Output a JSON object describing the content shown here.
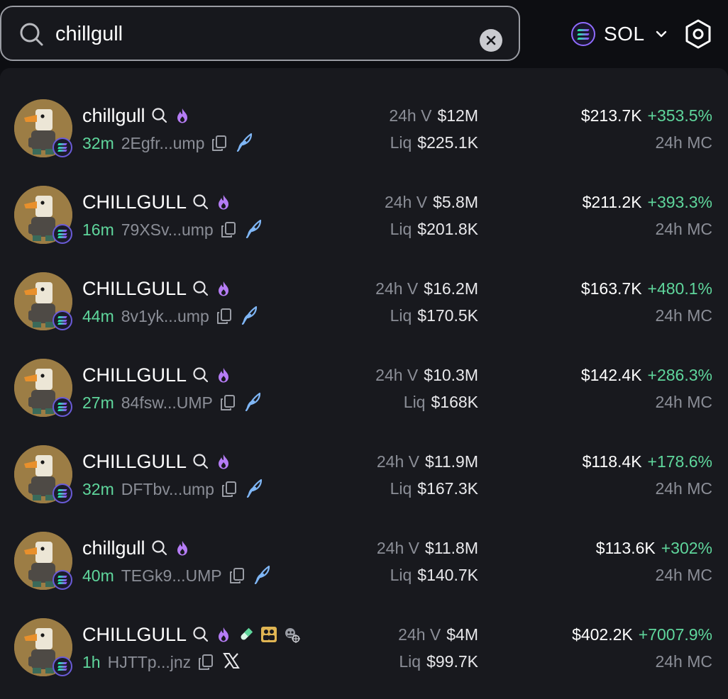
{
  "search": {
    "value": "chillgull",
    "placeholder": ""
  },
  "chain": {
    "label": "SOL",
    "icon": "solana-icon"
  },
  "labels": {
    "volume": "24h V",
    "liquidity": "Liq",
    "mc": "24h MC"
  },
  "colors": {
    "positive": "#5fd69c",
    "flame": "#b57cf5",
    "feather": "#7fb6f5"
  },
  "results": [
    {
      "name": "chillgull",
      "age": "32m",
      "address": "2Egfr...ump",
      "volume": "$12M",
      "liquidity": "$225.1K",
      "mc": "$213.7K",
      "change": "+353.5%",
      "social": "feather-icon",
      "extra_icons": []
    },
    {
      "name": "CHILLGULL",
      "age": "16m",
      "address": "79XSv...ump",
      "volume": "$5.8M",
      "liquidity": "$201.8K",
      "mc": "$211.2K",
      "change": "+393.3%",
      "social": "feather-icon",
      "extra_icons": []
    },
    {
      "name": "CHILLGULL",
      "age": "44m",
      "address": "8v1yk...ump",
      "volume": "$16.2M",
      "liquidity": "$170.5K",
      "mc": "$163.7K",
      "change": "+480.1%",
      "social": "feather-icon",
      "extra_icons": []
    },
    {
      "name": "CHILLGULL",
      "age": "27m",
      "address": "84fsw...UMP",
      "volume": "$10.3M",
      "liquidity": "$168K",
      "mc": "$142.4K",
      "change": "+286.3%",
      "social": "feather-icon",
      "extra_icons": []
    },
    {
      "name": "CHILLGULL",
      "age": "32m",
      "address": "DFTbv...ump",
      "volume": "$11.9M",
      "liquidity": "$167.3K",
      "mc": "$118.4K",
      "change": "+178.6%",
      "social": "feather-icon",
      "extra_icons": []
    },
    {
      "name": "chillgull",
      "age": "40m",
      "address": "TEGk9...UMP",
      "volume": "$11.8M",
      "liquidity": "$140.7K",
      "mc": "$113.6K",
      "change": "+302%",
      "social": "feather-icon",
      "extra_icons": []
    },
    {
      "name": "CHILLGULL",
      "age": "1h",
      "address": "HJTTp...jnz",
      "volume": "$4M",
      "liquidity": "$99.7K",
      "mc": "$402.2K",
      "change": "+7007.9%",
      "social": "x-icon",
      "extra_icons": [
        "pill-icon",
        "users-icon",
        "sniper-icon"
      ]
    }
  ]
}
